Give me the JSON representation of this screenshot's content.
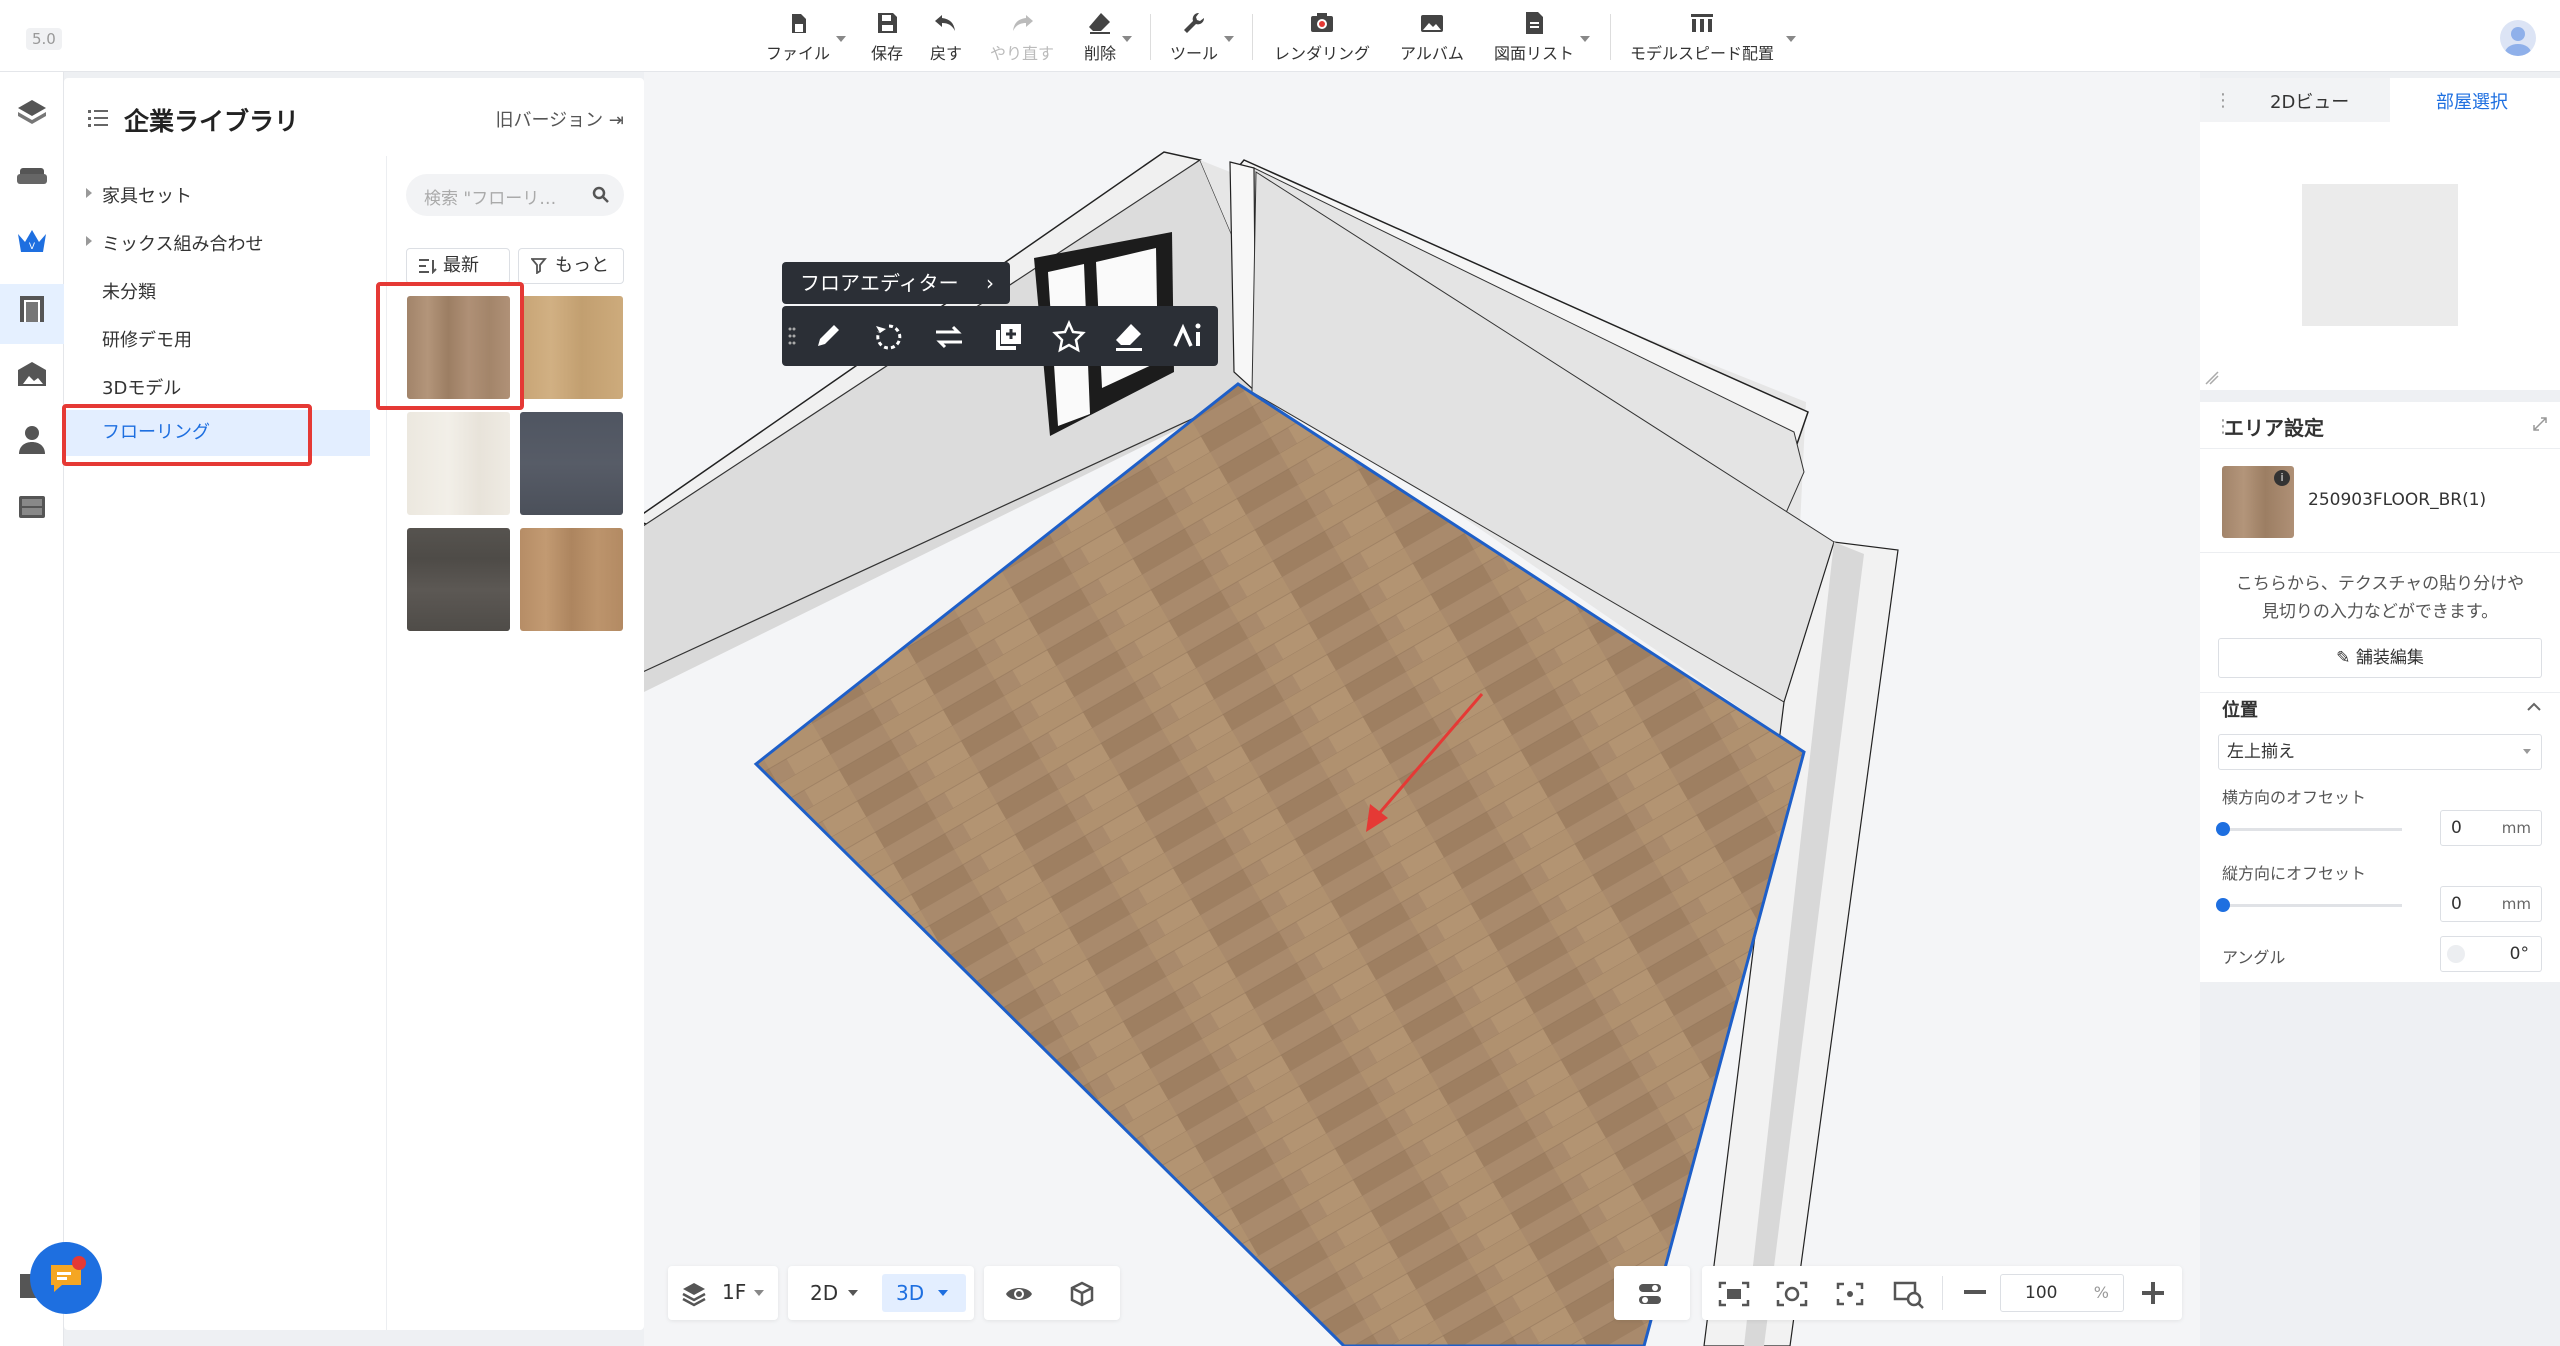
{
  "app": {
    "version": "5.0"
  },
  "toolbar": {
    "file": "ファイル",
    "save": "保存",
    "undo": "戻す",
    "redo": "やり直す",
    "delete": "削除",
    "tools": "ツール",
    "render": "レンダリング",
    "album": "アルバム",
    "drawings": "図面リスト",
    "model_speed": "モデルスピード配置"
  },
  "library": {
    "title": "企業ライブラリ",
    "old_version": "旧バージョン",
    "categories": [
      {
        "label": "家具セット",
        "expandable": true
      },
      {
        "label": "ミックス組み合わせ",
        "expandable": true
      },
      {
        "label": "未分類",
        "expandable": false
      },
      {
        "label": "研修デモ用",
        "expandable": false
      },
      {
        "label": "3Dモデル",
        "expandable": false
      },
      {
        "label": "フローリング",
        "expandable": false,
        "selected": true
      }
    ],
    "search_placeholder": "検索 \"フローリ…",
    "sort_latest": "最新",
    "filter_more": "もっと",
    "textures": [
      {
        "color": "#a98a6c",
        "selected": true
      },
      {
        "color": "#c9a777"
      },
      {
        "color": "#ece8e0"
      },
      {
        "color": "#505560"
      },
      {
        "color": "#55524e"
      },
      {
        "color": "#b88f68"
      }
    ]
  },
  "floor_toolbar": {
    "label": "フロアエディター"
  },
  "right_panel": {
    "tab_2d": "2Dビュー",
    "tab_room": "部屋選択",
    "area_title": "エリア設定",
    "material_name": "250903FLOOR_BR(1)",
    "description_line1": "こちらから、テクスチャの貼り分けや",
    "description_line2": "見切りの入力などができます。",
    "edit_button": "舗装編集",
    "position_title": "位置",
    "alignment": "左上揃え",
    "h_offset_label": "横方向のオフセット",
    "h_offset_value": "0",
    "v_offset_label": "縦方向にオフセット",
    "v_offset_value": "0",
    "unit": "mm",
    "angle_label": "アングル",
    "angle_value": "0",
    "angle_unit": "°"
  },
  "bottom": {
    "floor": "1F",
    "view2d": "2D",
    "view3d": "3D",
    "zoom": "100",
    "zoom_unit": "%"
  },
  "colors": {
    "accent": "#1e6fe0",
    "highlight": "#e53935",
    "floor": "#a98a6c"
  }
}
